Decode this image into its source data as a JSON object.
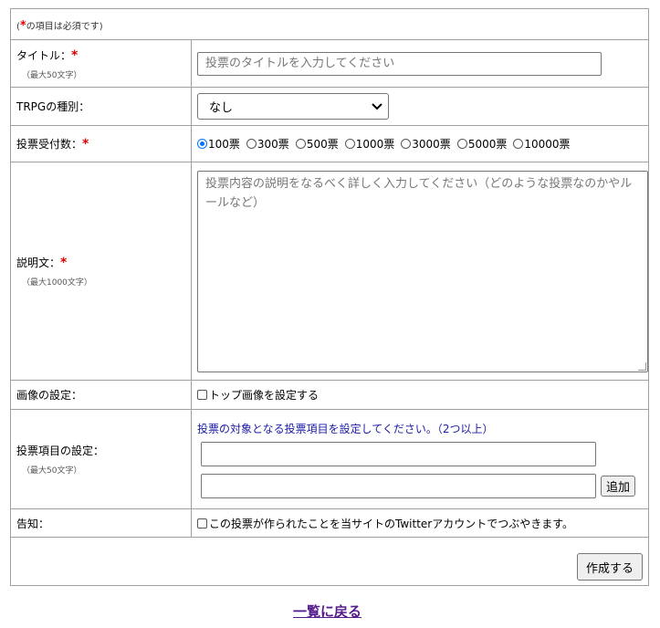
{
  "required_note": {
    "open": "(",
    "mark": "*",
    "text": "の項目は必須です)"
  },
  "title_field": {
    "label": "タイトル：",
    "required_mark": "*",
    "hint": "（最大50文字）",
    "placeholder": "投票のタイトルを入力してください"
  },
  "trpg_type": {
    "label": "TRPGの種別：",
    "selected": "なし"
  },
  "vote_limit": {
    "label": "投票受付数：",
    "required_mark": "*",
    "selected_index": 0,
    "options": [
      "100票",
      "300票",
      "500票",
      "1000票",
      "3000票",
      "5000票",
      "10000票"
    ]
  },
  "description": {
    "label": "説明文：",
    "required_mark": "*",
    "hint": "（最大1000文字）",
    "placeholder": "投票内容の説明をなるべく詳しく入力してください（どのような投票なのかやルールなど）"
  },
  "image_setting": {
    "label": "画像の設定：",
    "checkbox_label": "トップ画像を設定する"
  },
  "vote_items": {
    "label": "投票項目の設定：",
    "hint": "（最大50文字）",
    "instruction": "投票の対象となる投票項目を設定してください。（2つ以上）",
    "add_button": "追加"
  },
  "announce": {
    "label": "告知：",
    "checkbox_label": "この投票が作られたことを当サイトのTwitterアカウントでつぶやきます。"
  },
  "submit_button": "作成する",
  "back_link": "一覧に戻る",
  "colors": {
    "required": "#e00000",
    "instruction": "#1a1aa6",
    "link": "#551a8b",
    "radio_selected": "#0075ff"
  }
}
